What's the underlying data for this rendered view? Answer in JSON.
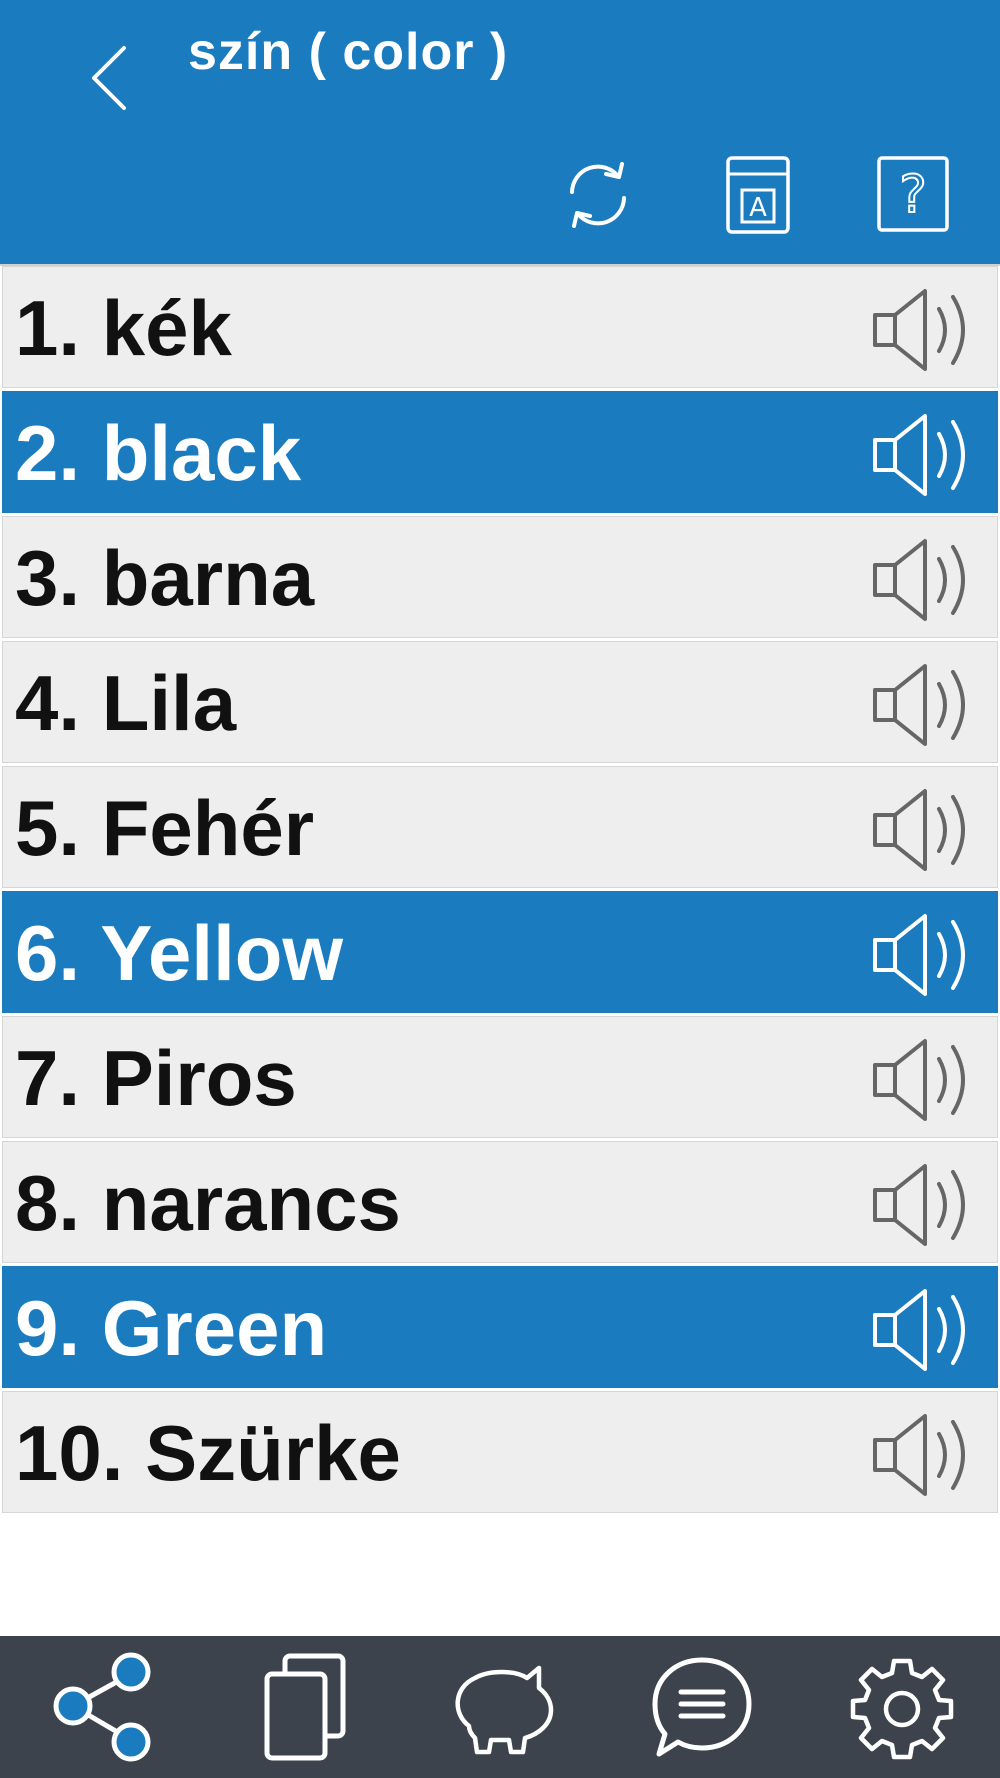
{
  "header": {
    "title": "szín ( color )",
    "back_icon": "chevron-left-icon",
    "tools": [
      {
        "name": "refresh",
        "icon": "refresh-icon"
      },
      {
        "name": "dictionary",
        "icon": "book-a-icon",
        "glyph": "A"
      },
      {
        "name": "help",
        "icon": "question-icon",
        "glyph": "?"
      }
    ]
  },
  "words": [
    {
      "label": "1. kék",
      "active": false
    },
    {
      "label": "2. black",
      "active": true
    },
    {
      "label": "3. barna",
      "active": false
    },
    {
      "label": "4. Lila",
      "active": false
    },
    {
      "label": "5. Fehér",
      "active": false
    },
    {
      "label": "6. Yellow",
      "active": true
    },
    {
      "label": "7. Piros",
      "active": false
    },
    {
      "label": "8. narancs",
      "active": false
    },
    {
      "label": "9. Green",
      "active": true
    },
    {
      "label": "10. Szürke",
      "active": false
    }
  ],
  "bottom_nav": [
    {
      "name": "share",
      "icon": "share-icon",
      "active": true
    },
    {
      "name": "cards",
      "icon": "cards-icon",
      "active": false
    },
    {
      "name": "savings",
      "icon": "piggy-bank-icon",
      "active": false
    },
    {
      "name": "chat",
      "icon": "chat-icon",
      "active": false
    },
    {
      "name": "settings",
      "icon": "gear-icon",
      "active": false
    }
  ],
  "colors": {
    "primary": "#1a7bbf",
    "row_bg": "#eeeeee",
    "nav_bg": "#3d434c",
    "text": "#111111",
    "speaker_inactive": "#666666"
  }
}
